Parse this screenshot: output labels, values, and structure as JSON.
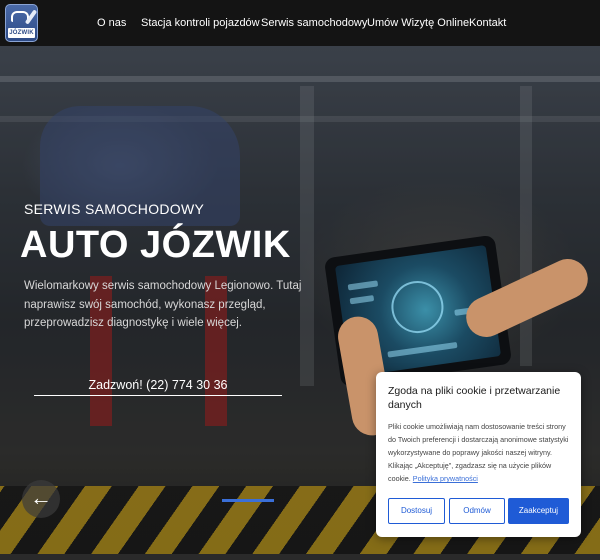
{
  "header": {
    "logo_text": "JÓZWIK",
    "nav": [
      {
        "label": "O nas"
      },
      {
        "label": "Stacja kontroli pojazdów"
      },
      {
        "label": "Serwis samochodowy"
      },
      {
        "label": "Umów Wizytę Online"
      },
      {
        "label": "Kontakt"
      }
    ]
  },
  "hero": {
    "subtitle": "SERWIS SAMOCHODOWY",
    "title": "AUTO JÓZWIK",
    "description": "Wielomarkowy serwis samochodowy Legionowo. Tutaj naprawisz swój samochód, wykonasz przegląd, przeprowadzisz diagnostykę i wiele więcej.",
    "call_label": "Zadzwoń! (22) 774 30 36",
    "prev_icon": "arrow-left-icon"
  },
  "cookie": {
    "title": "Zgoda na pliki cookie i przetwarzanie danych",
    "text": "Pliki cookie umożliwiają nam dostosowanie treści strony do Twoich preferencji i dostarczają anonimowe statystyki wykorzystywane do poprawy jakości naszej witryny. Klikając „Akceptuję\", zgadzasz się na użycie plików cookie.",
    "policy_link": "Polityka prywatności",
    "buttons": {
      "customize": "Dostosuj",
      "reject": "Odmów",
      "accept": "Zaakceptuj"
    }
  },
  "colors": {
    "accent": "#1f5bd6",
    "header_bg": "#141414",
    "slide_indicator": "#3a6fd8"
  }
}
